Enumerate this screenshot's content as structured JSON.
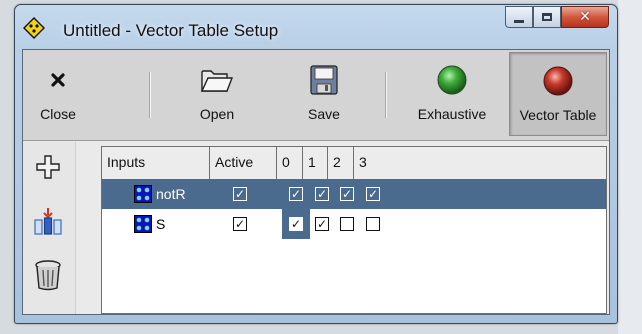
{
  "window": {
    "title": "Untitled - Vector Table Setup",
    "caption_buttons": {
      "minimize": "minimize-icon",
      "maximize": "maximize-icon",
      "close": "close-icon"
    }
  },
  "toolbar": {
    "close_label": "Close",
    "open_label": "Open",
    "save_label": "Save",
    "exhaustive_label": "Exhaustive",
    "vector_table_label": "Vector Table",
    "active_mode": "Vector Table"
  },
  "sidebar": {
    "items": [
      {
        "name": "add-icon"
      },
      {
        "name": "insert-vector-icon"
      },
      {
        "name": "trash-icon"
      }
    ]
  },
  "table": {
    "headers": [
      "Inputs",
      "Active",
      "0",
      "1",
      "2",
      "3"
    ],
    "rows": [
      {
        "name": "notR",
        "active": true,
        "values": [
          true,
          true,
          true,
          true
        ],
        "selected": true
      },
      {
        "name": "S",
        "active": true,
        "values": [
          true,
          true,
          false,
          false
        ],
        "selected": false
      }
    ]
  },
  "colors": {
    "selection": "#4a6b8d",
    "exhaustive_led": "#2f9a2f",
    "vector_table_led": "#b3261e"
  }
}
